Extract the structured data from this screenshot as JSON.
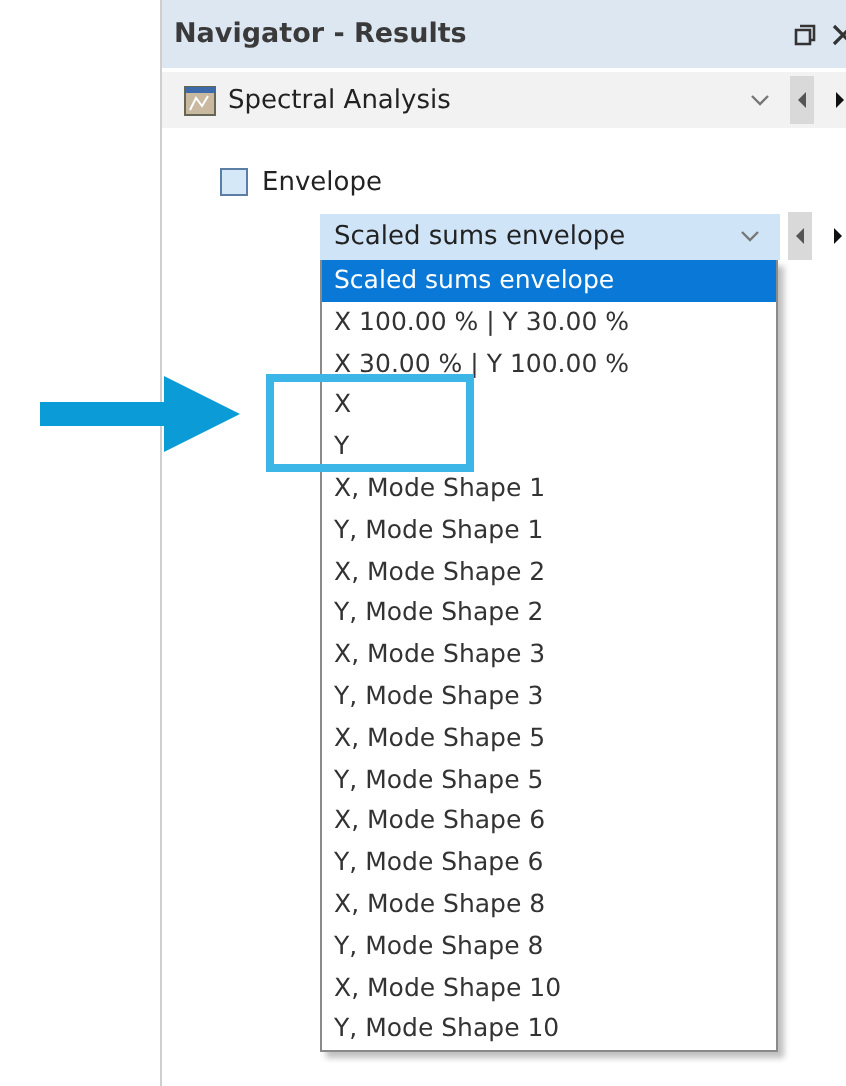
{
  "panel": {
    "title": "Navigator - Results"
  },
  "result_type": {
    "value": "Spectral Analysis"
  },
  "envelope": {
    "label": "Envelope",
    "checked": false
  },
  "combination": {
    "value": "Scaled sums envelope",
    "expanded": true
  },
  "options": [
    {
      "label": "Scaled sums envelope",
      "selected": true
    },
    {
      "label": "X 100.00 % | Y 30.00 %",
      "selected": false
    },
    {
      "label": "X 30.00 % | Y 100.00 %",
      "selected": false
    },
    {
      "label": "X",
      "selected": false
    },
    {
      "label": "Y",
      "selected": false
    },
    {
      "label": "X, Mode Shape 1",
      "selected": false
    },
    {
      "label": "Y, Mode Shape 1",
      "selected": false
    },
    {
      "label": "X, Mode Shape 2",
      "selected": false
    },
    {
      "label": "Y, Mode Shape 2",
      "selected": false
    },
    {
      "label": "X, Mode Shape 3",
      "selected": false
    },
    {
      "label": "Y, Mode Shape 3",
      "selected": false
    },
    {
      "label": "X, Mode Shape 5",
      "selected": false
    },
    {
      "label": "Y, Mode Shape 5",
      "selected": false
    },
    {
      "label": "X, Mode Shape 6",
      "selected": false
    },
    {
      "label": "Y, Mode Shape 6",
      "selected": false
    },
    {
      "label": "X, Mode Shape 8",
      "selected": false
    },
    {
      "label": "Y, Mode Shape 8",
      "selected": false
    },
    {
      "label": "X, Mode Shape 10",
      "selected": false
    },
    {
      "label": "Y, Mode Shape 10",
      "selected": false
    }
  ]
}
